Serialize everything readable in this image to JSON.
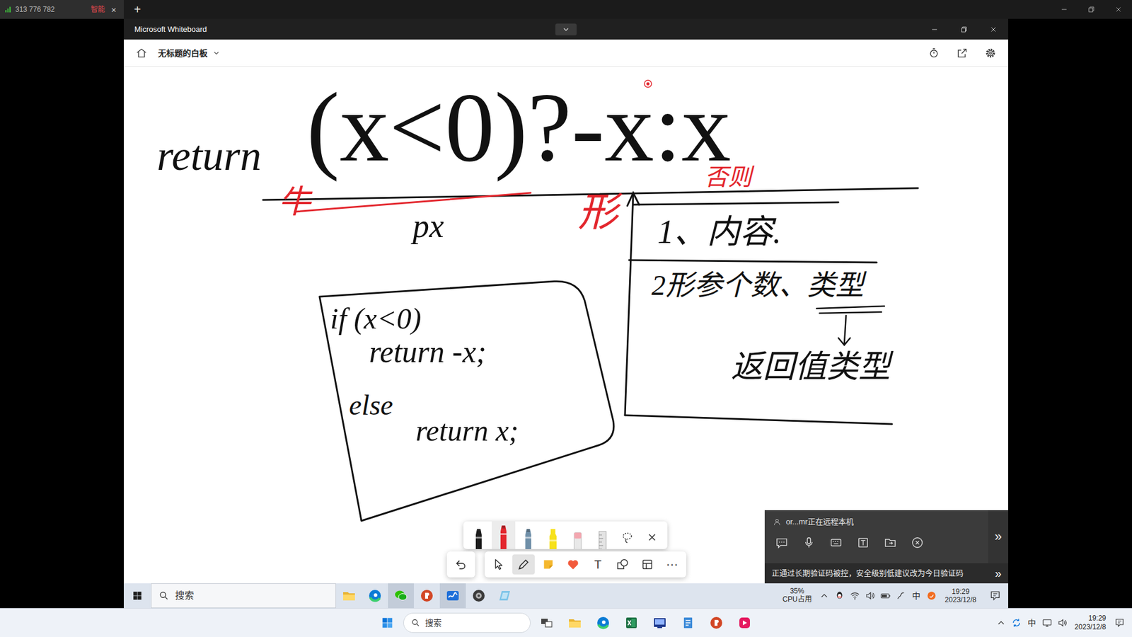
{
  "remote_tab": {
    "label": "313 776 782",
    "badge": "智能",
    "close": "×",
    "new_tab": "+"
  },
  "window": {
    "title": "Microsoft Whiteboard"
  },
  "board": {
    "name": "无标题的白板"
  },
  "canvas": {
    "items": [
      {
        "text": "return",
        "kind": "hand",
        "color": "#111111"
      },
      {
        "text": "(x<0)?-x:x",
        "kind": "typed",
        "color": "#111111"
      },
      {
        "text": "px",
        "kind": "hand",
        "color": "#111111"
      },
      {
        "text": "牛",
        "kind": "hand",
        "color": "#e3262d"
      },
      {
        "text": "形",
        "kind": "hand",
        "color": "#e3262d"
      },
      {
        "text": "否则",
        "kind": "hand",
        "color": "#e3262d"
      },
      {
        "text": "if (x<0)",
        "kind": "hand",
        "color": "#111111"
      },
      {
        "text": "return -x;",
        "kind": "hand",
        "color": "#111111"
      },
      {
        "text": "else",
        "kind": "hand",
        "color": "#111111"
      },
      {
        "text": "return x;",
        "kind": "hand",
        "color": "#111111"
      },
      {
        "text": "1、内容.",
        "kind": "hand",
        "color": "#111111"
      },
      {
        "text": "2形参个数、类型",
        "kind": "hand",
        "color": "#111111"
      },
      {
        "text": "返回值类型",
        "kind": "hand",
        "color": "#111111"
      }
    ]
  },
  "pen_tray": [
    {
      "kind": "pen",
      "color": "#1c1c1c",
      "selected": false
    },
    {
      "kind": "pen",
      "color": "#e3262d",
      "selected": true
    },
    {
      "kind": "pen",
      "color": "#6f8fa8",
      "selected": false
    },
    {
      "kind": "highlighter",
      "color": "#f7e11b",
      "selected": false
    },
    {
      "kind": "eraser",
      "selected": false
    },
    {
      "kind": "ruler",
      "selected": false
    },
    {
      "kind": "lasso",
      "selected": false
    },
    {
      "kind": "close"
    }
  ],
  "tools": [
    {
      "kind": "undo",
      "selected": false
    },
    {
      "kind": "select",
      "selected": false
    },
    {
      "kind": "pen",
      "selected": true
    },
    {
      "kind": "note",
      "selected": false
    },
    {
      "kind": "reaction",
      "selected": false
    },
    {
      "kind": "text",
      "label": "T",
      "selected": false
    },
    {
      "kind": "shapes",
      "selected": false
    },
    {
      "kind": "layout",
      "selected": false
    },
    {
      "kind": "more",
      "label": "⋯",
      "selected": false
    }
  ],
  "remote_panel": {
    "title": "or...mr正在远程本机",
    "actions": [
      {
        "kind": "chat"
      },
      {
        "kind": "mic"
      },
      {
        "kind": "keyboard"
      },
      {
        "kind": "textbox"
      },
      {
        "kind": "file"
      },
      {
        "kind": "disconnect"
      }
    ],
    "expand": "»",
    "notice": "正通过长期验证码被控，安全级别低建议改为今日验证码",
    "notice_expand": "»"
  },
  "inner_taskbar": {
    "search": "搜索",
    "apps": [
      {
        "kind": "explorer",
        "highlighted": false
      },
      {
        "kind": "edge",
        "highlighted": false
      },
      {
        "kind": "wechat",
        "highlighted": true
      },
      {
        "kind": "powerpoint",
        "highlighted": false
      },
      {
        "kind": "whiteboard",
        "highlighted": true
      },
      {
        "kind": "obs",
        "highlighted": false
      },
      {
        "kind": "snip",
        "highlighted": false
      }
    ],
    "cpu": "35%",
    "cpu_label": "CPU占用",
    "tray": [
      {
        "kind": "chevron"
      },
      {
        "kind": "qq"
      },
      {
        "kind": "wifi"
      },
      {
        "kind": "volume"
      },
      {
        "kind": "battery"
      },
      {
        "kind": "pen"
      },
      {
        "kind": "ime",
        "label": "中"
      },
      {
        "kind": "sogou"
      }
    ],
    "time": "19:29",
    "date": "2023/12/8"
  },
  "outer_taskbar": {
    "search": "搜索",
    "apps": [
      {
        "kind": "taskview"
      },
      {
        "kind": "explorer"
      },
      {
        "kind": "edge"
      },
      {
        "kind": "excel"
      },
      {
        "kind": "devcpp"
      },
      {
        "kind": "notepad"
      },
      {
        "kind": "powerpoint"
      },
      {
        "kind": "pinkapp"
      }
    ],
    "tray": [
      {
        "kind": "chevron"
      },
      {
        "kind": "sync"
      },
      {
        "kind": "ime",
        "label": "中"
      },
      {
        "kind": "monitor"
      },
      {
        "kind": "volume"
      }
    ],
    "time": "19:29",
    "date": "2023/12/8"
  }
}
